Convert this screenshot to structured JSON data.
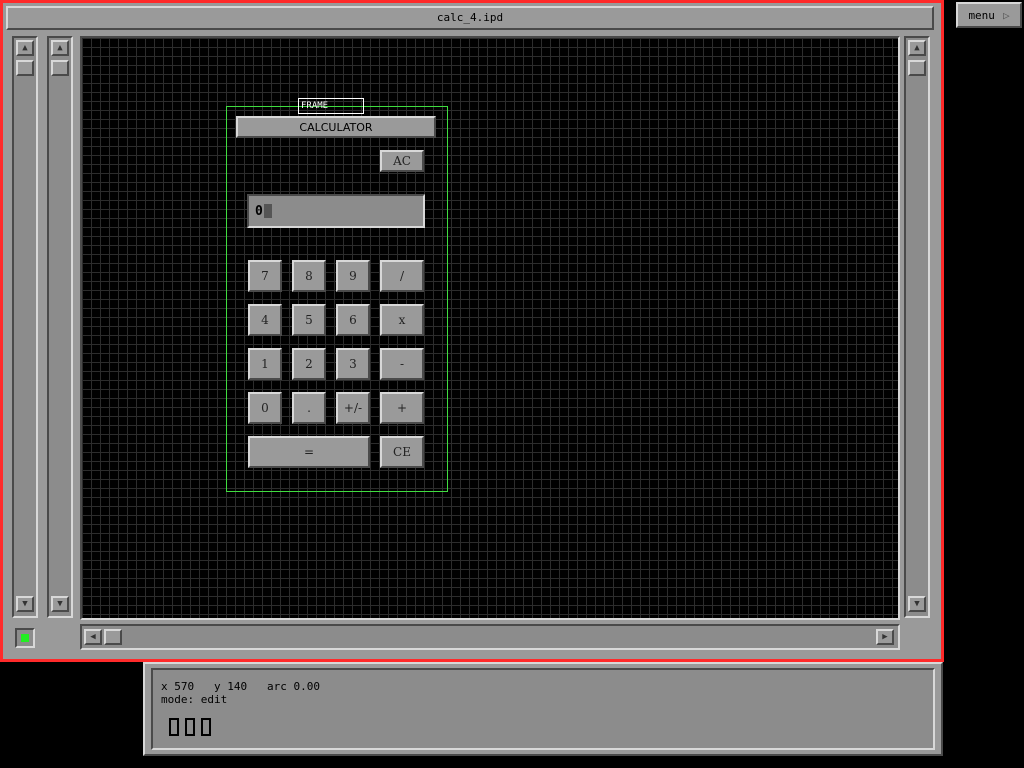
{
  "window": {
    "title": "calc_4.ipd"
  },
  "menu": {
    "label": "menu",
    "icon": "triangle-right-icon"
  },
  "calculator": {
    "frame_label": "FRAME",
    "title": "CALCULATOR",
    "clear_all": "AC",
    "display_value": "0",
    "rows": [
      [
        "7",
        "8",
        "9",
        "/"
      ],
      [
        "4",
        "5",
        "6",
        "x"
      ],
      [
        "1",
        "2",
        "3",
        "-"
      ],
      [
        "0",
        ".",
        "+/-",
        "+"
      ]
    ],
    "equals": "=",
    "clear_entry": "CE"
  },
  "info": {
    "x_label": "x 570",
    "y_label": "y 140",
    "arc_label": "arc 0.00",
    "mode_label": "mode: edit"
  },
  "colors": {
    "frame_border": "#ff2a2a",
    "panel_gray": "#9a9a9a",
    "canvas_bg": "#000000",
    "selection_green": "#3fdc3f",
    "status_led": "#22ee22"
  }
}
